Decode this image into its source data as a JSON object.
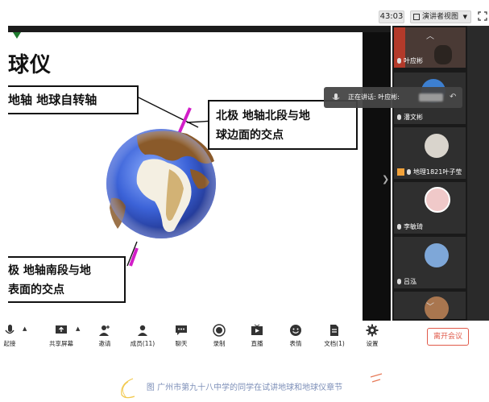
{
  "top_bar": {
    "timer": "43:03",
    "view_button_label": "演讲者视图"
  },
  "slide": {
    "title": "球仪",
    "callout_axis": "地轴  地球自转轴",
    "callout_north_line1": "北极  地轴北段与地",
    "callout_north_line2": "球边面的交点",
    "callout_south_line1": "极  地轴南段与地",
    "callout_south_line2": "表面的交点"
  },
  "speaking_popup": {
    "text": "正在讲话: 叶应彬:"
  },
  "participants": [
    {
      "name": "叶应彬"
    },
    {
      "name": "潘文彬"
    },
    {
      "name": "地理1821叶子莹"
    },
    {
      "name": "李敏琦"
    },
    {
      "name": "吕泓"
    }
  ],
  "toolbar": {
    "items": [
      {
        "label": "起接",
        "icon": "mic-icon"
      },
      {
        "label": "共享屏幕",
        "icon": "share-screen-icon"
      },
      {
        "label": "邀请",
        "icon": "invite-icon"
      },
      {
        "label": "成员(11)",
        "icon": "members-icon"
      },
      {
        "label": "聊天",
        "icon": "chat-icon"
      },
      {
        "label": "录制",
        "icon": "record-icon"
      },
      {
        "label": "直播",
        "icon": "live-icon"
      },
      {
        "label": "表情",
        "icon": "emoji-icon"
      },
      {
        "label": "文档(1)",
        "icon": "document-icon"
      },
      {
        "label": "设置",
        "icon": "settings-icon"
      }
    ],
    "leave_label": "离开会议"
  },
  "caption": "图 广州市第九十八中学的同学在试讲地球和地球仪章节",
  "colors": {
    "leave_red": "#e05a4a",
    "caption_blue": "#7d8fb8",
    "axis_magenta": "#d21ec8",
    "globe_ocean": "#3c63d8",
    "globe_land": "#8a5a2a"
  }
}
